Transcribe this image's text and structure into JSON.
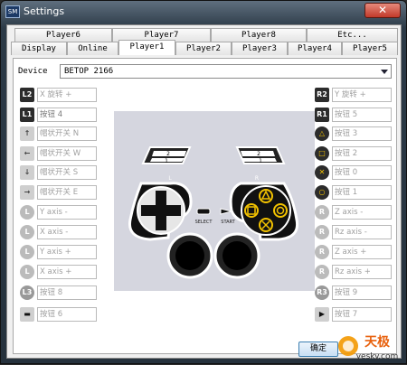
{
  "window": {
    "title": "Settings",
    "close_glyph": "✕",
    "app_icon_text": "SM"
  },
  "tabs_top": [
    "Player6",
    "Player7",
    "Player8",
    "Etc..."
  ],
  "tabs_bottom": [
    "Display",
    "Online",
    "Player1",
    "Player2",
    "Player3",
    "Player4",
    "Player5"
  ],
  "active_tab": "Player1",
  "device": {
    "label": "Device",
    "value": "BETOP 2166"
  },
  "left_mappings": [
    {
      "icon": "L2",
      "icon_name": "l2-button-icon",
      "value": "X 旋转 +"
    },
    {
      "icon": "L1",
      "icon_name": "l1-button-icon",
      "value": "按钮 4"
    },
    {
      "icon": "↑",
      "icon_name": "dpad-up-icon",
      "value": "帽状开关 N"
    },
    {
      "icon": "←",
      "icon_name": "dpad-left-icon",
      "value": "帽状开关 W"
    },
    {
      "icon": "↓",
      "icon_name": "dpad-down-icon",
      "value": "帽状开关 S"
    },
    {
      "icon": "→",
      "icon_name": "dpad-right-icon",
      "value": "帽状开关 E"
    },
    {
      "icon": "L",
      "icon_name": "left-stick-up-icon",
      "value": "Y axis -"
    },
    {
      "icon": "L",
      "icon_name": "left-stick-left-icon",
      "value": "X axis -"
    },
    {
      "icon": "L",
      "icon_name": "left-stick-down-icon",
      "value": "Y axis +"
    },
    {
      "icon": "L",
      "icon_name": "left-stick-right-icon",
      "value": "X axis +"
    },
    {
      "icon": "L3",
      "icon_name": "l3-button-icon",
      "value": "按钮 8"
    },
    {
      "icon": "▬",
      "icon_name": "select-button-icon",
      "value": "按钮 6"
    }
  ],
  "right_mappings": [
    {
      "icon": "R2",
      "icon_name": "r2-button-icon",
      "value": "Y 旋转 +"
    },
    {
      "icon": "R1",
      "icon_name": "r1-button-icon",
      "value": "按钮 5"
    },
    {
      "icon": "△",
      "icon_name": "triangle-button-icon",
      "value": "按钮 3"
    },
    {
      "icon": "□",
      "icon_name": "square-button-icon",
      "value": "按钮 2"
    },
    {
      "icon": "✕",
      "icon_name": "cross-button-icon",
      "value": "按钮 0"
    },
    {
      "icon": "○",
      "icon_name": "circle-button-icon",
      "value": "按钮 1"
    },
    {
      "icon": "R",
      "icon_name": "right-stick-up-icon",
      "value": "Z axis -"
    },
    {
      "icon": "R",
      "icon_name": "right-stick-left-icon",
      "value": "Rz axis -"
    },
    {
      "icon": "R",
      "icon_name": "right-stick-down-icon",
      "value": "Z axis +"
    },
    {
      "icon": "R",
      "icon_name": "right-stick-right-icon",
      "value": "Rz axis +"
    },
    {
      "icon": "R3",
      "icon_name": "r3-button-icon",
      "value": "按钮 9"
    },
    {
      "icon": "▶",
      "icon_name": "start-button-icon",
      "value": "按钮 7"
    }
  ],
  "controller": {
    "select_label": "SELECT",
    "start_label": "START",
    "left_label": "L",
    "right_label": "R",
    "shoulder_top": "2",
    "shoulder_bottom": "1"
  },
  "ok_button": "确定",
  "watermark": {
    "brand": "天极",
    "site": "yesky.com"
  },
  "colors": {
    "titlebar": "#2c3a47",
    "close": "#c23a2a",
    "pad_bg": "#d5d6df",
    "field_text": "#a0a0a0"
  }
}
